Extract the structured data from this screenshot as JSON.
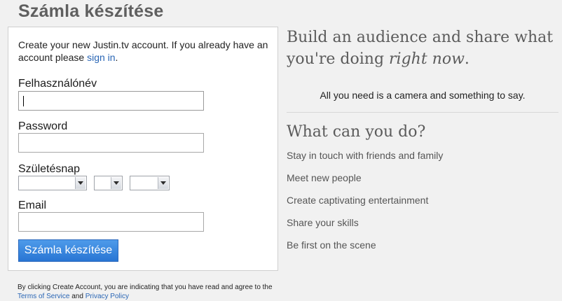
{
  "page": {
    "title": "Számla készítése"
  },
  "form": {
    "intro_text": "Create your new Justin.tv account. If you already have an account please ",
    "sign_in_link": "sign in",
    "intro_end": ".",
    "username_label": "Felhasználónév",
    "username_value": "",
    "password_label": "Password",
    "password_value": "",
    "birthday_label": "Születésnap",
    "birthday_month": "",
    "birthday_day": "",
    "birthday_year": "",
    "email_label": "Email",
    "email_value": "",
    "submit_label": "Számla készítése"
  },
  "legal": {
    "text_before": "By clicking Create Account, you are indicating that you have read and agree to the ",
    "terms_link": "Terms of Service",
    "and_text": " and ",
    "privacy_link": "Privacy Policy"
  },
  "promo": {
    "headline_part1": "Build an audience and share what you're doing ",
    "headline_emphasis": "right now",
    "headline_end": ".",
    "tagline": "All you need is a camera and something to say.",
    "section_title": "What can you do?",
    "features": [
      "Stay in touch with friends and family",
      "Meet new people",
      "Create captivating entertainment",
      "Share your skills",
      "Be first on the scene"
    ]
  }
}
